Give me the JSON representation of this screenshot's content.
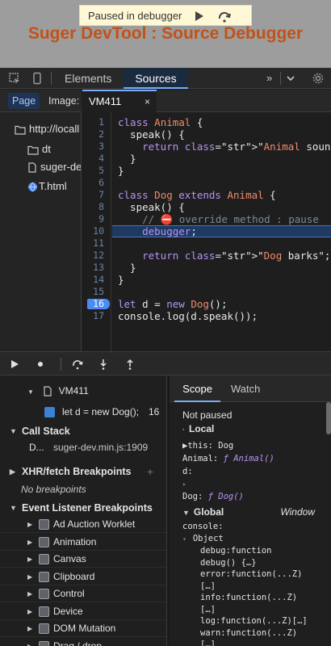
{
  "page": {
    "paused_text": "Paused in debugger",
    "title": "Suger DevTool : Source Debugger"
  },
  "devtools": {
    "tabs": [
      {
        "label": "Elements"
      },
      {
        "label": "Sources"
      }
    ],
    "more_label": "»"
  },
  "navigator": {
    "tabs": [
      {
        "label": "Page"
      },
      {
        "label": "Image:"
      }
    ],
    "tree": [
      {
        "label": "http://locall",
        "icon": "folder-icon"
      },
      {
        "label": "dt",
        "icon": "folder-icon"
      },
      {
        "label": "suger-dev",
        "icon": "file-icon"
      },
      {
        "label": "T.html",
        "icon": "globe-icon"
      }
    ]
  },
  "editor": {
    "file_tab": "VM411",
    "close_glyph": "×",
    "line_numbers": [
      "1",
      "2",
      "3",
      "4",
      "5",
      "6",
      "7",
      "8",
      "9",
      "10",
      "11",
      "12",
      "13",
      "14",
      "15",
      "16",
      "17"
    ],
    "lines": [
      "class Animal {",
      "  speak() {",
      "    return \"Animal sound\";",
      "  }",
      "}",
      "",
      "class Dog extends Animal {",
      "  speak() {",
      "    // ⛔ override method : pause",
      "    debugger;",
      "",
      "    return \"Dog barks\";",
      "  }",
      "}",
      "",
      "let d = new Dog();",
      "console.log(d.speak());"
    ]
  },
  "sidebar": {
    "callstack_file": "VM411",
    "callstack_code": "let d = new Dog();",
    "callstack_num": "16",
    "callstack_title": "Call Stack",
    "frame_name": "D...",
    "frame_loc": "suger-dev.min.js:1909",
    "xhr_title": "XHR/fetch Breakpoints",
    "xhr_empty": "No breakpoints",
    "event_title": "Event Listener Breakpoints",
    "events": [
      "Ad Auction Worklet",
      "Animation",
      "Canvas",
      "Clipboard",
      "Control",
      "Device",
      "DOM Mutation",
      "Drag / drop"
    ]
  },
  "scope": {
    "tabs": [
      "Scope",
      "Watch"
    ],
    "not_paused": "Not paused",
    "local_title": "Local",
    "this_line": "▶this: Dog",
    "animal_key": "Animal:",
    "animal_val": "ƒ Animal()",
    "d_key": "d:",
    "d_val": "▸",
    "dog_key": "Dog:",
    "dog_val": "ƒ Dog()",
    "global_title": "Global",
    "global_val": "Window",
    "console_key": "console:",
    "object_label": "Object",
    "props": [
      "debug:function",
      "debug() {…}",
      "error:function(...Z)",
      "[…]",
      "info:function(...Z)",
      "[…]",
      "log:function(...Z)[…]",
      "warn:function(...Z)",
      "[…]"
    ]
  }
}
